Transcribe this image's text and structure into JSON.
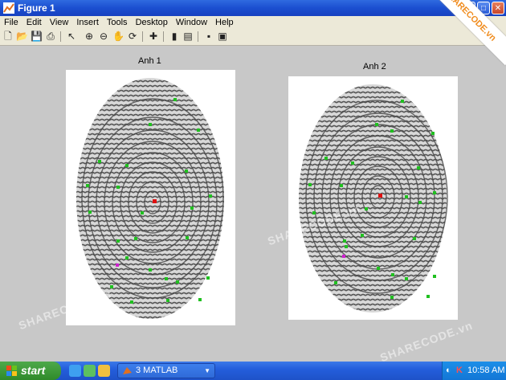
{
  "window": {
    "title": "Figure 1"
  },
  "menu": [
    "File",
    "Edit",
    "View",
    "Insert",
    "Tools",
    "Desktop",
    "Window",
    "Help"
  ],
  "toolbar": {
    "icons": [
      "new-file-icon",
      "open-icon",
      "save-icon",
      "print-icon",
      "pointer-icon",
      "zoom-in-icon",
      "zoom-out-icon",
      "pan-hand-icon",
      "rotate-3d-icon",
      "data-cursor-icon",
      "colorbar-icon",
      "legend-icon",
      "hide-plot-tools-icon",
      "show-plot-tools-icon"
    ]
  },
  "axes": [
    {
      "title": "Anh 1"
    },
    {
      "title": "Anh 2"
    }
  ],
  "watermark": {
    "text": "SHARECODE.vn",
    "badge": "SHARECODE.vn"
  },
  "taskbar": {
    "start_label": "start",
    "task_label": "3 MATLAB",
    "clock": "10:58 AM"
  },
  "colors": {
    "minutia_ending": "#20c020",
    "minutia_core": "#e01010",
    "minutia_bifurcation": "#d020d0"
  }
}
